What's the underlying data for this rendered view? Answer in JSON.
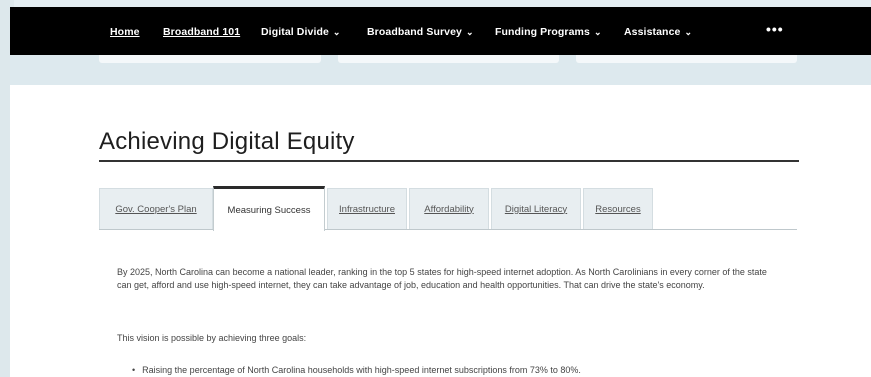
{
  "nav": {
    "items": [
      {
        "label": "Home"
      },
      {
        "label": "Broadband 101"
      },
      {
        "label": "Digital Divide"
      },
      {
        "label": "Broadband Survey"
      },
      {
        "label": "Funding Programs"
      },
      {
        "label": "Assistance"
      }
    ],
    "more": "•••"
  },
  "page": {
    "title": "Achieving Digital Equity"
  },
  "tabs": [
    {
      "label": "Gov. Cooper's Plan",
      "active": false
    },
    {
      "label": "Measuring Success",
      "active": true
    },
    {
      "label": "Infrastructure",
      "active": false
    },
    {
      "label": "Affordability",
      "active": false
    },
    {
      "label": "Digital Literacy",
      "active": false
    },
    {
      "label": "Resources",
      "active": false
    }
  ],
  "body": {
    "intro": "By 2025, North Carolina can become a national leader, ranking in the top 5 states for high-speed internet adoption. As North Carolinians in every corner of the state can get, afford and use high-speed internet, they can take advantage of job, education and health opportunities. That can drive the state's economy.",
    "goals_lead": "This vision is possible by achieving three goals:",
    "goals": [
      "Raising the percentage of North Carolina households with high-speed internet subscriptions from 73% to 80%."
    ]
  }
}
